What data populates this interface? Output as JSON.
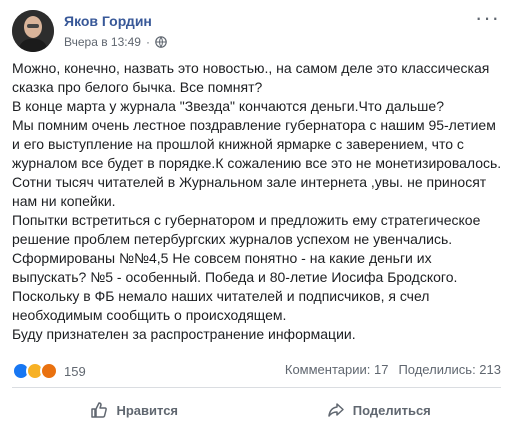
{
  "post": {
    "author": "Яков Гордин",
    "timestamp": "Вчера в 13:49",
    "separator": "·",
    "more": "···",
    "lines": [
      "Можно, конечно, назвать это новостью., на самом деле это классическая",
      "сказка про белого бычка. Все помнят?",
      "В конце марта у журнала \"Звезда\" кончаются деньги.Что дальше?",
      "Мы помним очень лестное поздравление губернатора с нашим 95-летием",
      "и его выступление на прошлой книжной ярмарке с заверением, что с",
      "журналом все будет в порядке.К сожалению все это не монетизировалось.",
      "Сотни тысяч читателей в Журнальном зале интернета ,увы. не приносят",
      "нам ни копейки.",
      "Попытки встретиться с губернатором и предложить ему стратегическое",
      "решение проблем петербургских журналов успехом не увенчались.",
      "Сформированы №№4,5 Не совсем понятно - на какие деньги их",
      "выпускать? №5 - особенный. Победа и 80-летие Иосифа Бродского.",
      "Поскольку в ФБ немало наших читателей и подписчиков, я счел",
      "необходимым сообщить о происходящем.",
      "Буду признателен за распространение информации."
    ]
  },
  "reactions": {
    "count": "159",
    "colors": {
      "like": "#1877f2",
      "sad": "#f7b125",
      "angry": "#e9710f"
    }
  },
  "stats": {
    "comments": "Комментарии: 17",
    "shares": "Поделились: 213"
  },
  "actions": {
    "like_label": "Нравится",
    "share_label": "Поделиться"
  },
  "colors": {
    "author_link": "#385898",
    "secondary_text": "#606770",
    "divider": "#dadde1"
  }
}
